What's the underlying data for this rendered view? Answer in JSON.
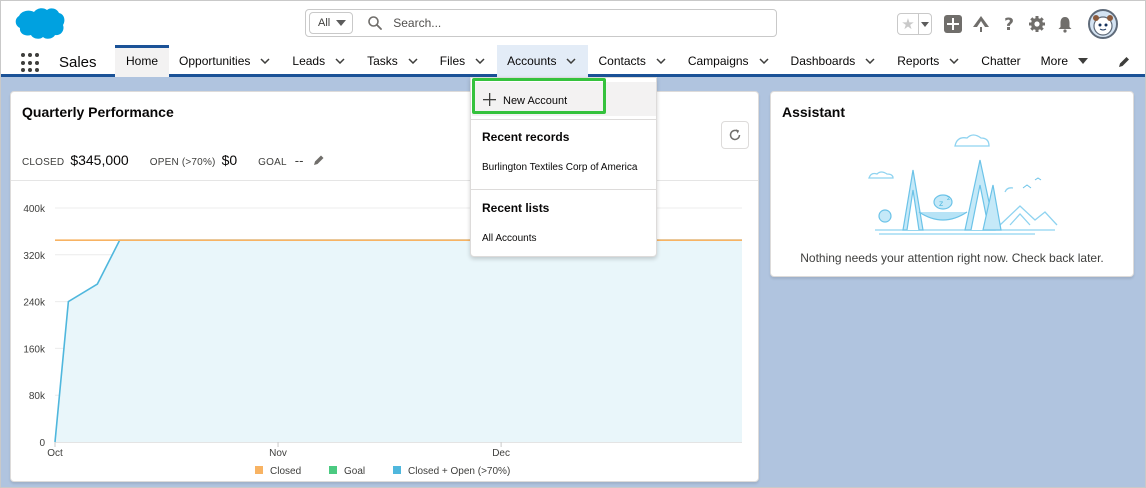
{
  "search": {
    "scope": "All",
    "placeholder": "Search..."
  },
  "app": {
    "name": "Sales"
  },
  "nav": {
    "items": [
      {
        "label": "Home"
      },
      {
        "label": "Opportunities"
      },
      {
        "label": "Leads"
      },
      {
        "label": "Tasks"
      },
      {
        "label": "Files"
      },
      {
        "label": "Accounts"
      },
      {
        "label": "Contacts"
      },
      {
        "label": "Campaigns"
      },
      {
        "label": "Dashboards"
      },
      {
        "label": "Reports"
      },
      {
        "label": "Chatter"
      },
      {
        "label": "More"
      }
    ]
  },
  "dropdown": {
    "new_label": "New Account",
    "recent_records_heading": "Recent records",
    "recent_records": [
      "Burlington Textiles Corp of America"
    ],
    "recent_lists_heading": "Recent lists",
    "recent_lists": [
      "All Accounts"
    ]
  },
  "performance": {
    "title": "Quarterly Performance",
    "closed_label": "CLOSED",
    "closed_value": "$345,000",
    "open_label": "OPEN (>70%)",
    "open_value": "$0",
    "goal_label": "GOAL",
    "goal_value": "--"
  },
  "assistant": {
    "title": "Assistant",
    "message": "Nothing needs your attention right now. Check back later."
  },
  "colors": {
    "closed": "#f8b363",
    "goal": "#4bca81",
    "closed_plus_open": "#4fb7dd",
    "area_fill": "#e9f6fa",
    "nav_accent": "#1b5297",
    "highlight": "#35c23d"
  },
  "chart_data": {
    "type": "line",
    "y_tick_labels": [
      "400k",
      "320k",
      "240k",
      "160k",
      "80k",
      "0"
    ],
    "x_tick_labels": [
      "Oct",
      "Nov",
      "Dec"
    ],
    "ylim": [
      0,
      400000
    ],
    "series": [
      {
        "name": "Closed",
        "color": "#f8b363",
        "points": [
          [
            0,
            345000
          ],
          [
            1,
            345000
          ],
          [
            3,
            345000
          ],
          [
            3.08,
            345000
          ]
        ]
      },
      {
        "name": "Goal",
        "color": "#4bca81",
        "points": []
      },
      {
        "name": "Closed + Open (>70%)",
        "color": "#4fb7dd",
        "points": [
          [
            0,
            0
          ],
          [
            0.06,
            240000
          ],
          [
            0.19,
            270000
          ],
          [
            0.29,
            345000
          ],
          [
            3.08,
            345000
          ]
        ]
      }
    ],
    "legend": [
      "Closed",
      "Goal",
      "Closed + Open (>70%)"
    ],
    "legend_position": "bottom"
  }
}
